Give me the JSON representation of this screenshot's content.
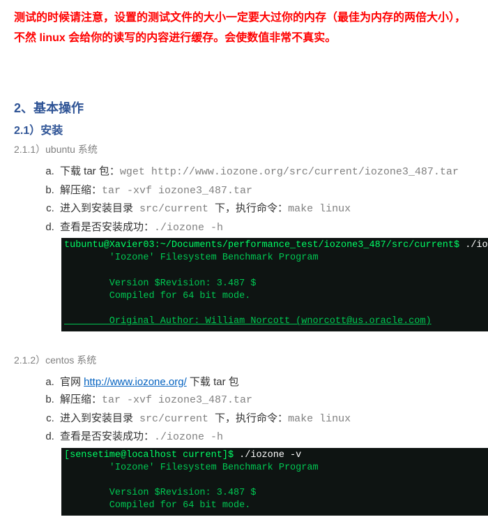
{
  "warning": "测试的时候请注意，设置的测试文件的大小一定要大过你的内存（最佳为内存的两倍大小），不然 linux 会给你的读写的内容进行缓存。会使数值非常不真实。",
  "section": {
    "h2": "2、基本操作",
    "h3": "2.1）安装",
    "ubuntu": {
      "label": "2.1.1）ubuntu 系统",
      "a_text": "下载 tar 包：",
      "a_cmd": "wget  http://www.iozone.org/src/current/iozone3_487.tar",
      "b_text": "解压缩：",
      "b_cmd": "tar -xvf iozone3_487.tar",
      "c_text": "进入到安装目录",
      "c_cmd1": " src/current ",
      "c_text2": "下，执行命令：",
      "c_cmd2": "make linux",
      "d_text": "查看是否安装成功：",
      "d_cmd": "./iozone -h",
      "term_prompt": "tubuntu@Xavier03:~/Documents/performance_test/iozone3_487/src/current$",
      "term_cmd_typed": " ./iozone -v",
      "term_line1": "        'Iozone' Filesystem Benchmark Program",
      "term_blank": " ",
      "term_line2": "        Version $Revision: 3.487 $",
      "term_line3": "        Compiled for 64 bit mode.",
      "term_line4": "        Original Author: William Norcott (wnorcott@us.oracle.com)"
    },
    "centos": {
      "label": "2.1.2）centos 系统",
      "a_text1": "官网 ",
      "a_link": "http://www.iozone.org/",
      "a_text2": " 下载 tar 包",
      "b_text": "解压缩：",
      "b_cmd": "tar -xvf iozone3_487.tar",
      "c_text": "进入到安装目录",
      "c_cmd1": " src/current ",
      "c_text2": "下，执行命令：",
      "c_cmd2": "make linux",
      "d_text": "查看是否安装成功：",
      "d_cmd": "./iozone -h",
      "term_prompt": "[sensetime@localhost current]$",
      "term_cmd_typed": " ./iozone -v",
      "term_line1": "        'Iozone' Filesystem Benchmark Program",
      "term_blank": " ",
      "term_line2": "        Version $Revision: 3.487 $",
      "term_line3": "        Compiled for 64 bit mode."
    }
  }
}
